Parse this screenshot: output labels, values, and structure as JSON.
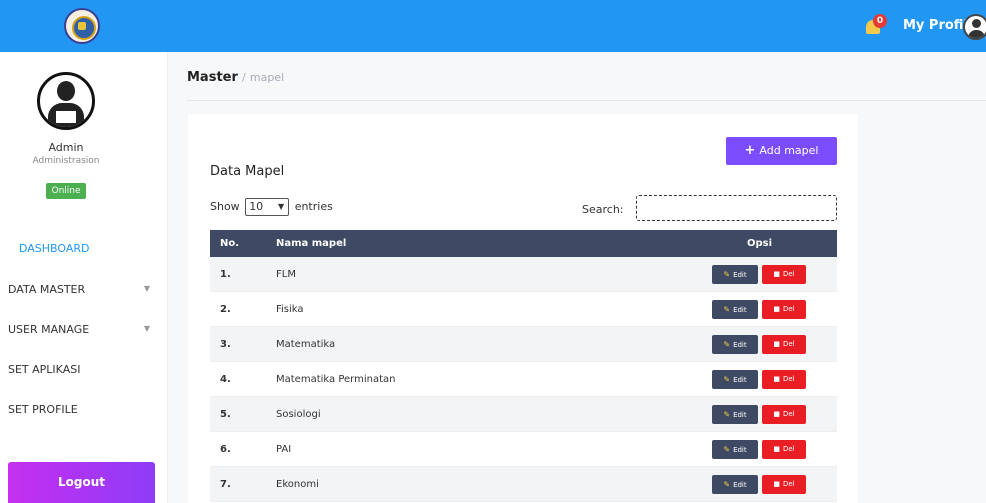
{
  "topbar": {
    "notification_count": "0",
    "profile_label": "My Profile"
  },
  "sidebar": {
    "user_name": "Admin",
    "user_role": "Administrasion",
    "status": "Online",
    "items": [
      {
        "label": "DASHBOARD",
        "active": true
      },
      {
        "label": "DATA MASTER",
        "has_submenu": true
      },
      {
        "label": "USER MANAGE",
        "has_submenu": true
      },
      {
        "label": "SET APLIKASI"
      },
      {
        "label": "SET PROFILE"
      }
    ],
    "logout_label": "Logout"
  },
  "breadcrumb": {
    "main": "Master",
    "separator": "/",
    "sub": "mapel"
  },
  "card": {
    "add_button": "Add mapel",
    "title": "Data Mapel",
    "show_label": "Show",
    "entries_value": "10",
    "entries_label": "entries",
    "search_label": "Search:",
    "search_value": ""
  },
  "table": {
    "headers": [
      "No.",
      "Nama mapel",
      "Opsi"
    ],
    "edit_label": "Edit",
    "delete_label": "Del",
    "rows": [
      {
        "no": "1.",
        "name": "FLM"
      },
      {
        "no": "2.",
        "name": "Fisika"
      },
      {
        "no": "3.",
        "name": "Matematika"
      },
      {
        "no": "4.",
        "name": "Matematika Perminatan"
      },
      {
        "no": "5.",
        "name": "Sosiologi"
      },
      {
        "no": "6.",
        "name": "PAI"
      },
      {
        "no": "7.",
        "name": "Ekonomi"
      }
    ]
  },
  "icons": {
    "bell": "bell-icon",
    "add": "plus-icon",
    "edit": "pencil-icon",
    "delete": "trash-icon",
    "caret": "chevron-down-icon"
  },
  "colors": {
    "topbar": "#2196f3",
    "table_header": "#3e4a63",
    "add_button": "#7c4dff",
    "delete_button": "#e91e24",
    "online": "#4caf50"
  }
}
